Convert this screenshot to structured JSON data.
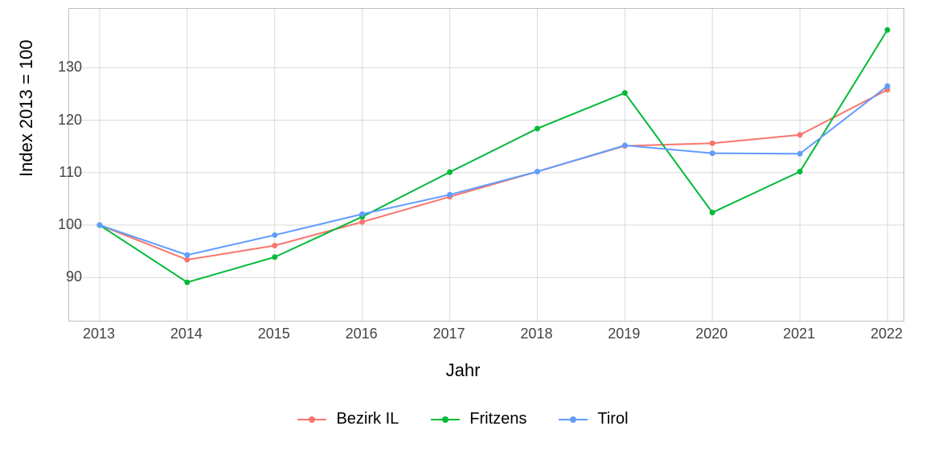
{
  "chart_data": {
    "type": "line",
    "title": "",
    "xlabel": "Jahr",
    "ylabel": "Index  2013  =  100",
    "categories": [
      "2013",
      "2014",
      "2015",
      "2016",
      "2017",
      "2018",
      "2019",
      "2020",
      "2021",
      "2022"
    ],
    "series": [
      {
        "name": "Bezirk IL",
        "color": "#F8766D",
        "values": [
          100,
          93.4,
          96.1,
          100.6,
          105.4,
          110.2,
          115.1,
          115.6,
          117.2,
          125.8
        ]
      },
      {
        "name": "Fritzens",
        "color": "#00BA38",
        "values": [
          100,
          89.1,
          93.9,
          101.6,
          110.1,
          118.4,
          125.2,
          102.4,
          110.2,
          137.2
        ]
      },
      {
        "name": "Tirol",
        "color": "#619CFF",
        "values": [
          100,
          94.3,
          98.1,
          102.1,
          105.8,
          110.2,
          115.2,
          113.7,
          113.6,
          126.5
        ]
      }
    ],
    "ylim": [
      83,
      140
    ],
    "yticks": [
      90,
      100,
      110,
      120,
      130
    ],
    "legend_position": "bottom",
    "grid": true
  }
}
